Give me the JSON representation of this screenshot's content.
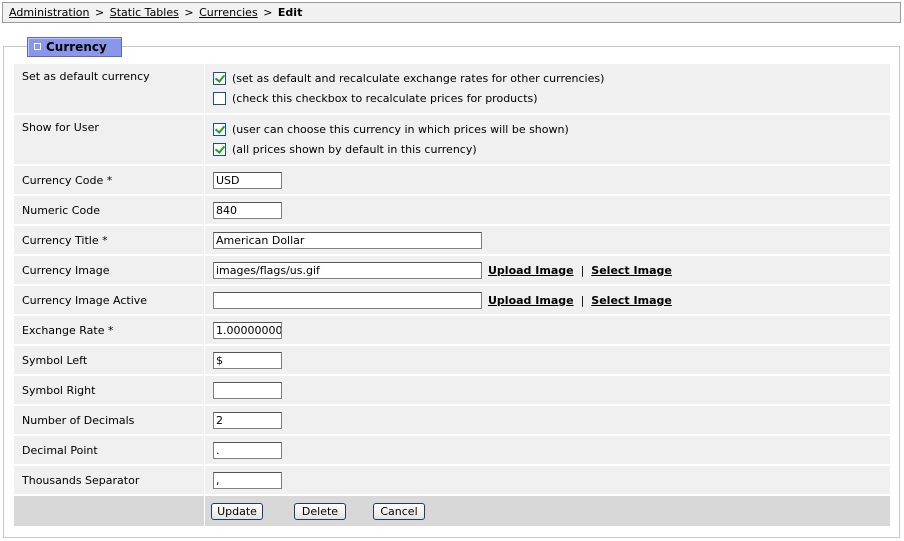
{
  "breadcrumb": {
    "items": [
      "Administration",
      "Static Tables",
      "Currencies"
    ],
    "separator": ">",
    "current": "Edit"
  },
  "section": {
    "title": "Currency"
  },
  "default_currency": {
    "label": "Set as default currency",
    "options": [
      {
        "text": "(set as default and recalculate exchange rates for other currencies)",
        "checked": true
      },
      {
        "text": "(check this checkbox to recalculate prices for products)",
        "checked": false
      }
    ]
  },
  "show_for_user": {
    "label": "Show for User",
    "options": [
      {
        "text": "(user can choose this currency in which prices will be shown)",
        "checked": true
      },
      {
        "text": "(all prices shown by default in this currency)",
        "checked": true
      }
    ]
  },
  "fields": {
    "currency_code": {
      "label": "Currency Code *",
      "value": "USD"
    },
    "numeric_code": {
      "label": "Numeric Code",
      "value": "840"
    },
    "currency_title": {
      "label": "Currency Title *",
      "value": "American Dollar"
    },
    "currency_image": {
      "label": "Currency Image",
      "value": "images/flags/us.gif"
    },
    "currency_image_active": {
      "label": "Currency Image Active",
      "value": ""
    },
    "exchange_rate": {
      "label": "Exchange Rate *",
      "value": "1.00000000"
    },
    "symbol_left": {
      "label": "Symbol Left",
      "value": "$"
    },
    "symbol_right": {
      "label": "Symbol Right",
      "value": ""
    },
    "number_of_decimals": {
      "label": "Number of Decimals",
      "value": "2"
    },
    "decimal_point": {
      "label": "Decimal Point",
      "value": "."
    },
    "thousands_separator": {
      "label": "Thousands Separator",
      "value": ","
    }
  },
  "image_links": {
    "upload": "Upload Image",
    "select": "Select Image",
    "divider": "|"
  },
  "buttons": {
    "update": "Update",
    "delete": "Delete",
    "cancel": "Cancel"
  },
  "colors": {
    "section_tab": "#8a96e8",
    "row_bg": "#f0f0f0",
    "button_bar": "#d8d8d8",
    "checkmark": "#21a121"
  }
}
